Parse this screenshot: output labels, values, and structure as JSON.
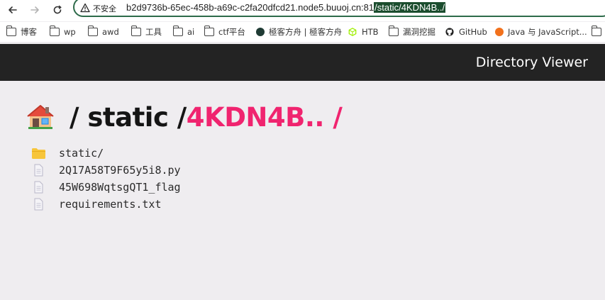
{
  "browser": {
    "insecure_label": "不安全",
    "url_host": "b2d9736b-65ec-458b-a69c-c2fa20dfcd21.node5.buuoj.cn:81",
    "url_path": "/static/4KDN4B../"
  },
  "bookmarks": [
    {
      "label": "博客",
      "icon": "folder-icon"
    },
    {
      "label": "wp",
      "icon": "folder-icon"
    },
    {
      "label": "awd",
      "icon": "folder-icon"
    },
    {
      "label": "工具",
      "icon": "folder-icon"
    },
    {
      "label": "ai",
      "icon": "folder-icon"
    },
    {
      "label": "ctf平台",
      "icon": "folder-icon"
    },
    {
      "label": "極客方舟 | 極客方舟",
      "icon": "site-icon"
    },
    {
      "label": "HTB",
      "icon": "htb-icon"
    },
    {
      "label": "漏洞挖掘",
      "icon": "folder-icon"
    },
    {
      "label": "GitHub",
      "icon": "github-icon"
    },
    {
      "label": "Java 与 JavaScript...",
      "icon": "site-icon"
    }
  ],
  "app": {
    "title": "Directory Viewer"
  },
  "breadcrumb": {
    "home_icon": "house-icon",
    "parts": [
      " / static / ",
      "4KDN4B.. /"
    ]
  },
  "files": [
    {
      "name": "static/",
      "type": "folder"
    },
    {
      "name": "2Q17A58T9F65y5i8.py",
      "type": "file"
    },
    {
      "name": "45W698WqtsgQT1_flag",
      "type": "file"
    },
    {
      "name": "requirements.txt",
      "type": "file"
    }
  ],
  "colors": {
    "header_bg": "#232323",
    "accent": "#f0246f",
    "page_bg": "#efedf0",
    "folder": "#f7c53b",
    "file_icon": "#b9b7c8"
  }
}
